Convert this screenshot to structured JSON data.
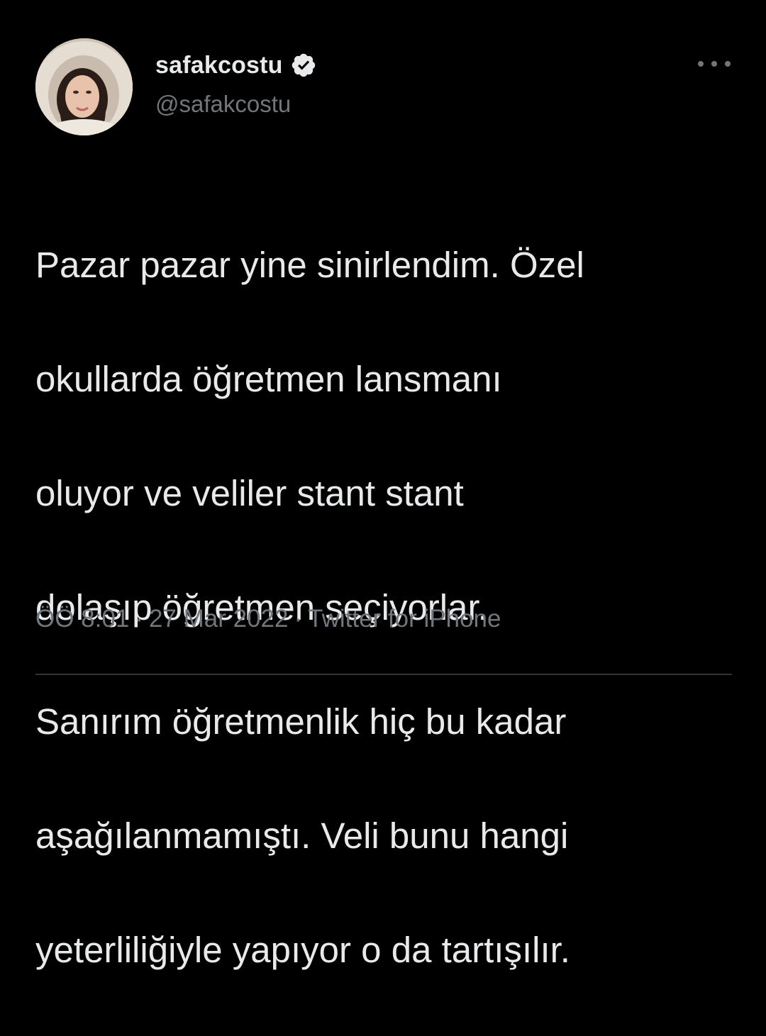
{
  "user": {
    "display_name": "safakcostu",
    "handle": "@safakcostu",
    "verified": true
  },
  "tweet": {
    "text_lines": [
      "Pazar pazar yine sinirlendim. Özel",
      "okullarda öğretmen lansmanı",
      "oluyor ve veliler stant stant",
      "dolaşıp öğretmen seçiyorlar.",
      "Sanırım öğretmenlik hiç bu kadar",
      "aşağılanmamıştı. Veli bunu hangi",
      "yeterliliğiyle yapıyor o da tartışılır."
    ],
    "time": "ÖÖ 8:01",
    "date": "27 Mar 2022",
    "separator": "·",
    "source": "Twitter for iPhone"
  },
  "icons": {
    "verified": "verified-badge-icon",
    "more": "more-horizontal-icon"
  },
  "colors": {
    "background": "#000000",
    "primary_text": "#e7e9ea",
    "secondary_text": "#71767b",
    "divider": "#2f3336"
  }
}
